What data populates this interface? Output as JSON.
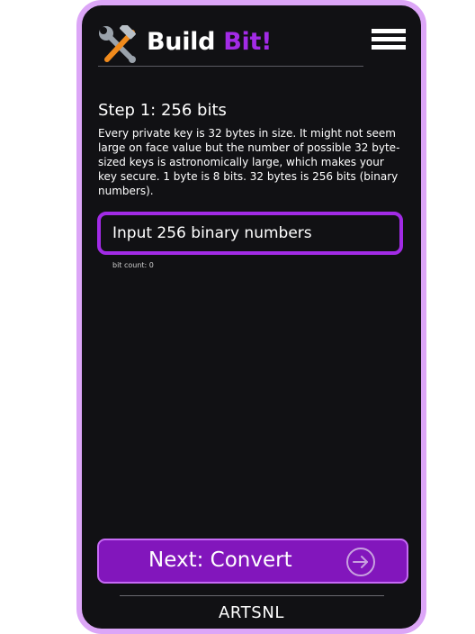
{
  "header": {
    "brand_part1": "Build ",
    "brand_part2": "Bit!",
    "logo_icon": "hammer-and-wrench-icon",
    "menu_icon": "hamburger-menu-icon"
  },
  "step": {
    "title": "Step 1: 256 bits",
    "description": "Every private key is 32 bytes in size. It might not seem large on face value but the number of possible 32 byte-sized keys is astronomically large, which makes your key secure. 1 byte is 8 bits. 32 bytes is 256 bits (binary numbers)."
  },
  "input": {
    "value": "",
    "placeholder": "Input 256 binary numbers",
    "bit_count_label": "bit count: 0"
  },
  "next_button": {
    "label": "Next: Convert",
    "icon": "circle-arrow-right-icon"
  },
  "footer": {
    "text": "ARTSNL"
  },
  "colors": {
    "accent": "#a22be6",
    "frame": "#dca6f7",
    "button": "#8216bc",
    "background": "#111114"
  }
}
